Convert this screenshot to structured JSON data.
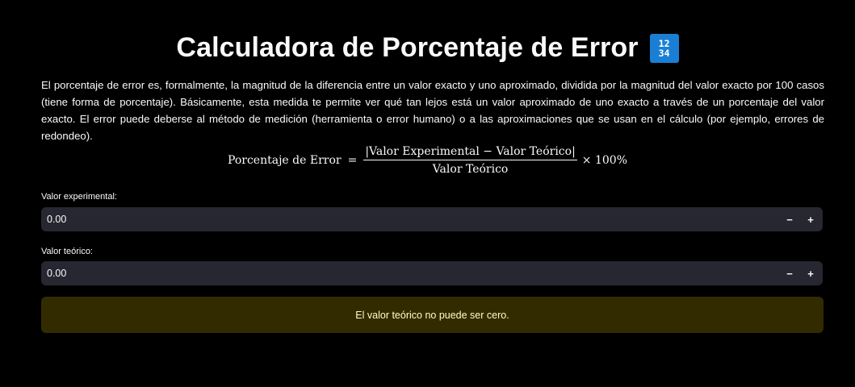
{
  "header": {
    "title": "Calculadora de Porcentaje de Error",
    "icon_name": "input-numbers-icon",
    "icon_top": "12",
    "icon_bottom": "34"
  },
  "intro": {
    "text": "El porcentaje de error es, formalmente, la magnitud de la diferencia entre un valor exacto y uno aproximado, dividida por la magnitud del valor exacto por 100 casos (tiene forma de porcentaje). Básicamente, esta medida te permite ver qué tan lejos está un valor aproximado de uno exacto a través de un porcentaje del valor exacto. El error puede deberse al método de medición (herramienta o error humano) o a las aproximaciones que se usan en el cálculo (por ejemplo, errores de redondeo)."
  },
  "formula": {
    "lhs": "Porcentaje de Error",
    "equals": "=",
    "numerator": "|Valor Experimental − Valor Teórico|",
    "denominator": "Valor Teórico",
    "times": "× 100%"
  },
  "inputs": [
    {
      "label": "Valor experimental:",
      "value": "0.00",
      "minus": "−",
      "plus": "+"
    },
    {
      "label": "Valor teórico:",
      "value": "0.00",
      "minus": "−",
      "plus": "+"
    }
  ],
  "warning": {
    "text": "El valor teórico no puede ser cero."
  },
  "colors": {
    "background": "#000000",
    "input_bg": "#262730",
    "warning_bg": "#332b00",
    "warning_text": "#ffffc2",
    "icon_bg": "#1a7fd4"
  }
}
